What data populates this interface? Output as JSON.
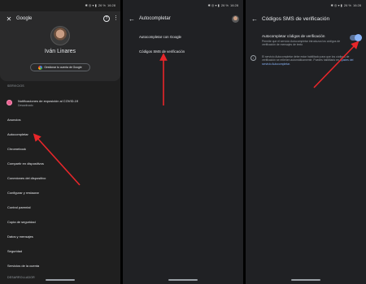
{
  "status": {
    "icons": "✱ ◎ ▾ ▮",
    "battery": "26 %",
    "time": "16:28"
  },
  "panel1": {
    "app_title": "Google",
    "user_name": "Iván Linares",
    "manage_account": "Gestionar tu cuenta de Google",
    "section_services": "SERVICIOS",
    "items": [
      {
        "label": "Notificaciones de exposición al COVID-19",
        "sub": "Desactivado"
      },
      {
        "label": "Anuncios"
      },
      {
        "label": "Autocompletar"
      },
      {
        "label": "Chromebook"
      },
      {
        "label": "Compartir en dispositivos"
      },
      {
        "label": "Conexiones del dispositivo"
      },
      {
        "label": "Configurar y restaurar"
      },
      {
        "label": "Control parental"
      },
      {
        "label": "Copia de seguridad"
      },
      {
        "label": "Datos y mensajes"
      },
      {
        "label": "Seguridad"
      },
      {
        "label": "Servicios de la cuenta"
      }
    ],
    "section_dev": "DESARROLLADOR"
  },
  "panel2": {
    "title": "Autocompletar",
    "items": [
      {
        "label": "Autocompletar con Google"
      },
      {
        "label": "Códigos SMS de verificación"
      }
    ]
  },
  "panel3": {
    "title": "Códigos SMS de verificación",
    "setting_title": "Autocompletar códigos de verificación",
    "setting_desc": "Permite que el servicio Autocompletar introduzca los códigos de verificación de mensajes de texto",
    "toggle_on": true,
    "info_text": "El servicio Autocompletar debe estar habilitado para que los códigos de verificación se rellenen automáticamente. Puedes habilitarlo en ",
    "info_link": "Ajustes del servicio Autocompletar."
  },
  "colors": {
    "accent": "#8ab4f8",
    "arrow": "#e8262a",
    "covid": "#ea5f8f"
  }
}
